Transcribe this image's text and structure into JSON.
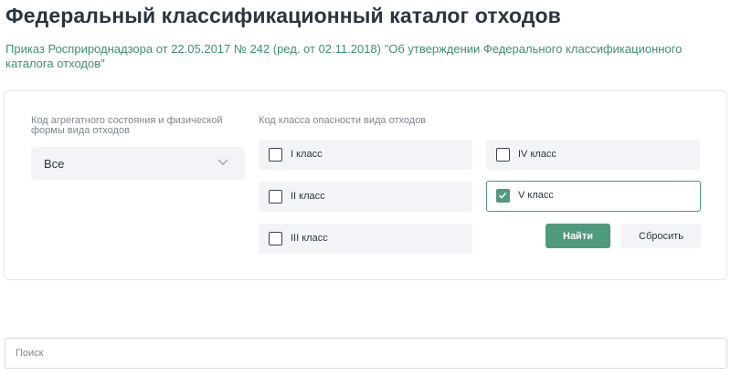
{
  "header": {
    "title": "Федеральный классификационный каталог отходов",
    "subtitle": "Приказ Росприроднадзора от 22.05.2017 № 242 (ред. от 02.11.2018) \"Об утверждении Федерального классификационного каталога отходов\""
  },
  "filters": {
    "state_label": "Код агрегатного состояния и физической формы вида отходов",
    "state_value": "Все",
    "class_label": "Код класса опасности вида отходов",
    "classes": [
      {
        "label": "I класс",
        "checked": false
      },
      {
        "label": "II класс",
        "checked": false
      },
      {
        "label": "III класс",
        "checked": false
      },
      {
        "label": "IV класс",
        "checked": false
      },
      {
        "label": "V класс",
        "checked": true
      }
    ],
    "find_label": "Найти",
    "reset_label": "Сбросить"
  },
  "search": {
    "placeholder": "Поиск",
    "value": ""
  },
  "colors": {
    "accent": "#4e9a7c",
    "link": "#3f8f6e",
    "text": "#2b3440",
    "muted": "#7b8591",
    "tile": "#f2f4f7"
  }
}
